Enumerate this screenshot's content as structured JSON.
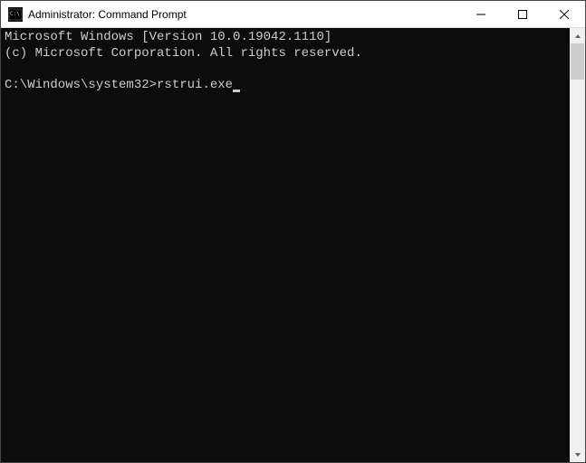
{
  "window": {
    "title": "Administrator: Command Prompt"
  },
  "terminal": {
    "line1": "Microsoft Windows [Version 10.0.19042.1110]",
    "line2": "(c) Microsoft Corporation. All rights reserved.",
    "blank": "",
    "prompt": "C:\\Windows\\system32>",
    "command": "rstrui.exe"
  }
}
